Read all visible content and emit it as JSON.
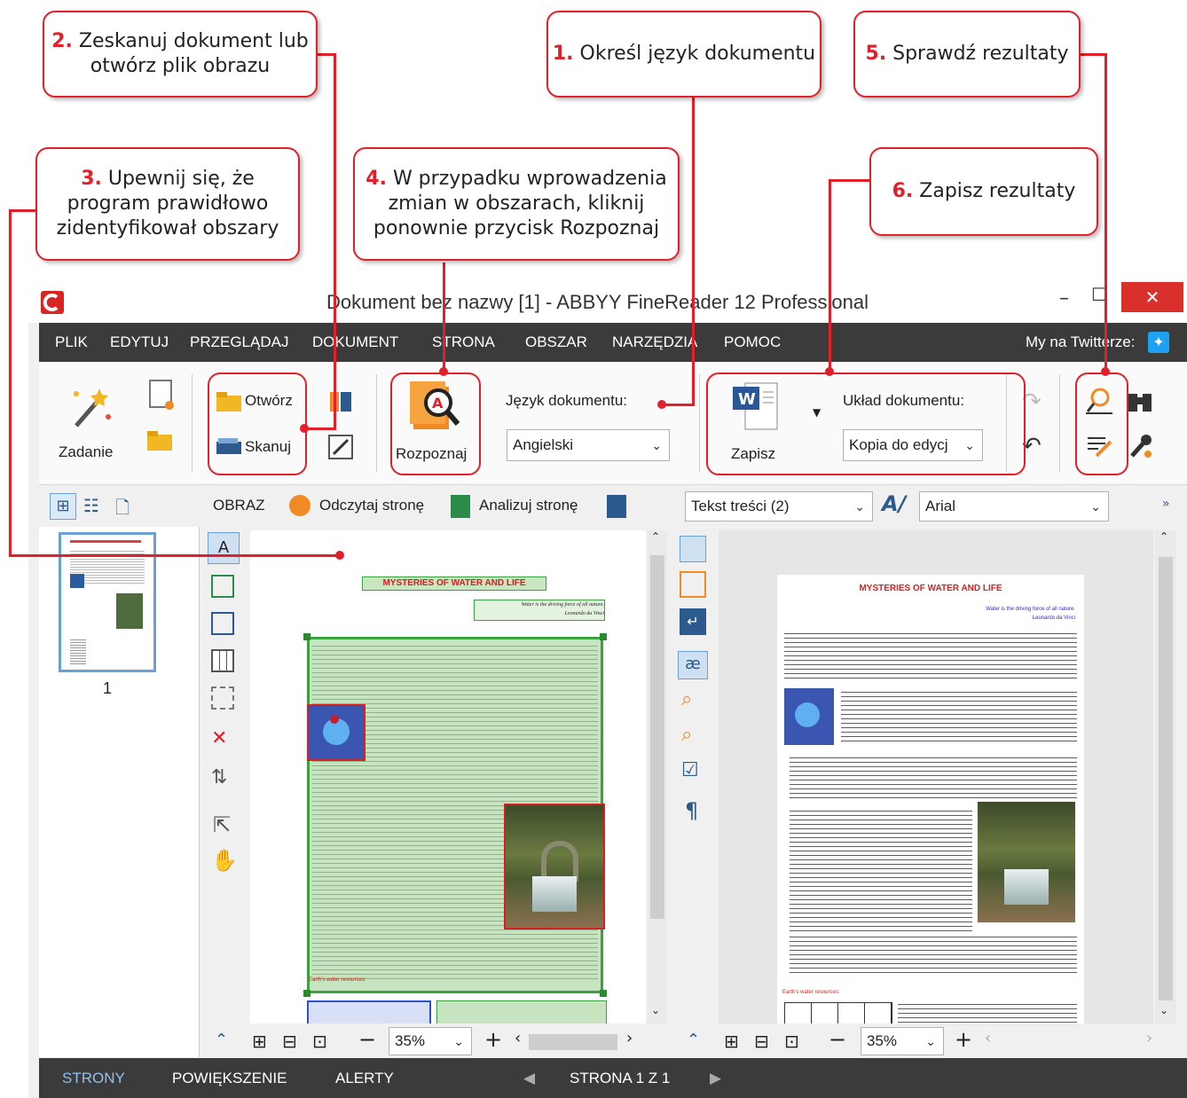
{
  "callouts": {
    "c1": {
      "num": "1.",
      "text": "Określ język dokumentu"
    },
    "c2": {
      "num": "2.",
      "text": "Zeskanuj dokument lub otwórz plik obrazu"
    },
    "c3": {
      "num": "3.",
      "text": "Upewnij się, że program prawidłowo zidentyfikował obszary"
    },
    "c4": {
      "num": "4.",
      "text": "W przypadku wprowadzenia zmian w obszarach, kliknij ponownie przycisk Rozpoznaj"
    },
    "c5": {
      "num": "5.",
      "text": "Sprawdź rezultaty"
    },
    "c6": {
      "num": "6.",
      "text": "Zapisz rezultaty"
    }
  },
  "window": {
    "title": "Dokument bez nazwy [1] - ABBYY FineReader 12 Professional",
    "minimize": "–",
    "maximize": "☐",
    "close": "✕"
  },
  "menu": {
    "items": [
      "PLIK",
      "EDYTUJ",
      "PRZEGLĄDAJ",
      "DOKUMENT",
      "STRONA",
      "OBSZAR",
      "NARZĘDZIA",
      "POMOC"
    ],
    "twitter": "My na Twitterze:"
  },
  "toolbar": {
    "task": "Zadanie",
    "open": "Otwórz",
    "scan": "Skanuj",
    "recognize": "Rozpoznaj",
    "language_label": "Język dokumentu:",
    "language_value": "Angielski",
    "save": "Zapisz",
    "layout_label": "Układ dokumentu:",
    "layout_value": "Kopia do edycj"
  },
  "image_panel": {
    "title": "OBRAZ",
    "read_page": "Odczytaj stronę",
    "analyze_page": "Analizuj stronę",
    "zoom": "35%"
  },
  "text_panel": {
    "style": "Tekst treści (2)",
    "font": "Arial",
    "zoom": "35%"
  },
  "pages_panel": {
    "page_number": "1"
  },
  "document": {
    "heading": "MYSTERIES OF WATER AND LIFE",
    "quote": "Water is the driving force of all nature.",
    "author": "Leonardo da Vinci",
    "section": "Earth's water resources:"
  },
  "statusbar": {
    "pages": "STRONY",
    "zoom": "POWIĘKSZENIE",
    "alerts": "ALERTY",
    "page_of": "STRONA 1 Z 1"
  },
  "colors": {
    "accent": "#e3202a",
    "menu_bg": "#3b3b3b",
    "twitter": "#1da1f2"
  }
}
